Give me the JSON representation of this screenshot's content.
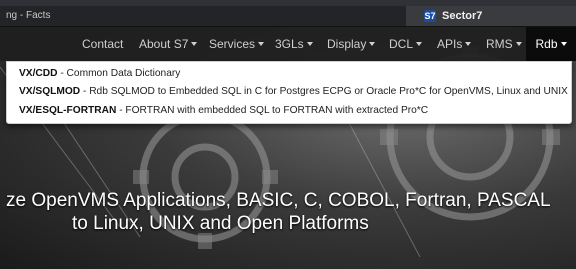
{
  "browser": {
    "tab_left_title": "ng - Facts",
    "active_tab_title": "Sector7",
    "active_tab_favicon": "S7"
  },
  "nav": {
    "items": [
      {
        "label": "Contact",
        "has_caret": false
      },
      {
        "label": "About S7",
        "has_caret": true
      },
      {
        "label": "Services",
        "has_caret": true
      },
      {
        "label": "3GLs",
        "has_caret": true
      },
      {
        "label": "Display",
        "has_caret": true
      },
      {
        "label": "DCL",
        "has_caret": true
      },
      {
        "label": "APIs",
        "has_caret": true
      },
      {
        "label": "RMS",
        "has_caret": true
      },
      {
        "label": "Rdb",
        "has_caret": true,
        "active": true
      }
    ]
  },
  "dropdown": {
    "items": [
      {
        "name": "VX/CDD",
        "desc": " - Common Data Dictionary"
      },
      {
        "name": "VX/SQLMOD",
        "desc": " - Rdb SQLMOD to Embedded SQL in C for Postgres ECPG or Oracle Pro*C for OpenVMS, Linux and UNIX"
      },
      {
        "name": "VX/ESQL-FORTRAN",
        "desc": " - FORTRAN with embedded SQL to FORTRAN with extracted Pro*C"
      }
    ]
  },
  "hero": {
    "line1": "ze OpenVMS Applications, BASIC, C, COBOL, Fortran, PASCAL",
    "line2": "to Linux, UNIX and Open Platforms"
  },
  "colors": {
    "navbar_bg": "#1e1e1e",
    "active_nav_bg": "#0b0b0b",
    "favicon_bg": "#1b4e9c"
  }
}
